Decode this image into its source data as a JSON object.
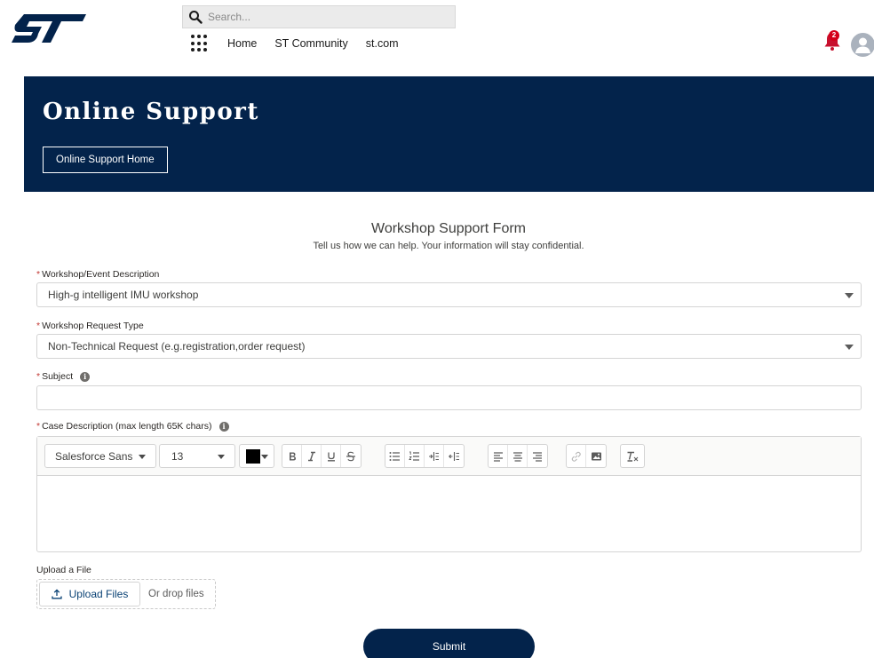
{
  "header": {
    "logo_alt": "ST",
    "search_placeholder": "Search...",
    "nav": [
      "Home",
      "ST Community",
      "st.com"
    ],
    "notifications_count": "2"
  },
  "banner": {
    "title": "Online Support",
    "home_button": "Online Support Home"
  },
  "form": {
    "title": "Workshop Support Form",
    "subtitle": "Tell us how we can help. Your information will stay confidential.",
    "required_mark": "*",
    "workshop": {
      "label": "Workshop/Event Description",
      "value": "High-g intelligent IMU workshop"
    },
    "request_type": {
      "label": "Workshop Request Type",
      "value": "Non-Technical Request (e.g.registration,order request)"
    },
    "subject": {
      "label": "Subject",
      "value": ""
    },
    "description": {
      "label": "Case Description (max length 65K chars)",
      "font_family": "Salesforce Sans",
      "font_size": "13",
      "text_color": "#000000",
      "value": ""
    },
    "upload": {
      "label": "Upload a File",
      "button": "Upload Files",
      "drop_text": "Or drop files"
    },
    "submit": "Submit"
  },
  "colors": {
    "brand_navy": "#03234b",
    "required_red": "#c23934",
    "badge_red": "#d4001a"
  }
}
